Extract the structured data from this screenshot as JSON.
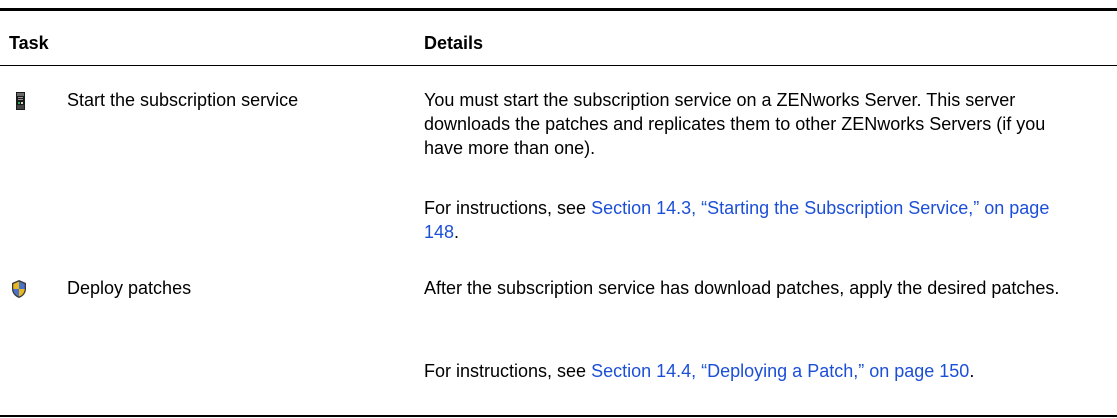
{
  "table": {
    "headers": {
      "task": "Task",
      "details": "Details"
    },
    "rows": [
      {
        "icon": "server-tower-icon",
        "task": "Start the subscription service",
        "details": "You must start the subscription service on a ZENworks Server. This server downloads the patches and replicates them to other ZENworks Servers (if you have more than one).",
        "instructions_prefix": "For instructions, see ",
        "instructions_link": "Section 14.3, “Starting the Subscription Service,” on page 148",
        "instructions_suffix": "."
      },
      {
        "icon": "shield-icon",
        "task": "Deploy patches",
        "details": "After the subscription service has download patches, apply the desired patches.",
        "instructions_prefix": "For instructions, see ",
        "instructions_link": "Section 14.4, “Deploying a Patch,” on page 150",
        "instructions_suffix": "."
      }
    ]
  },
  "colors": {
    "link": "#1c4fd8",
    "rule": "#000000"
  }
}
